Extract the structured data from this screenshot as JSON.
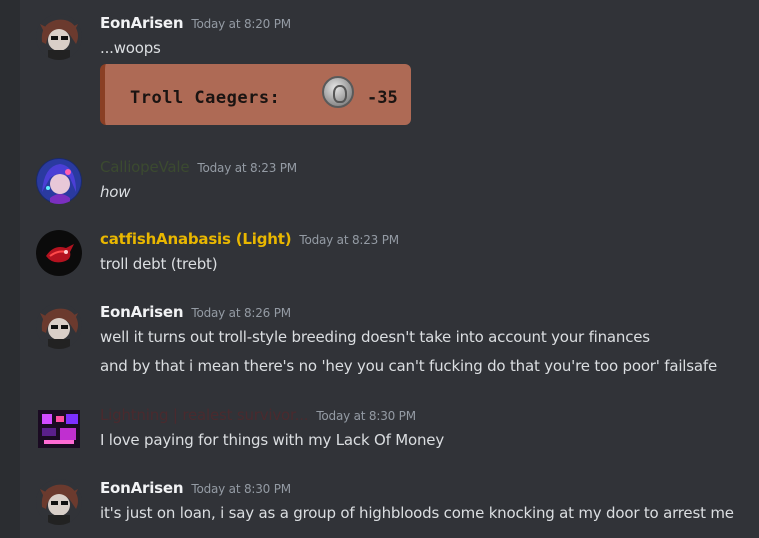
{
  "messages": [
    {
      "username": "EonArisen",
      "username_color": "#f2f3f5",
      "timestamp": "Today at 8:20 PM",
      "lines": [
        "...woops"
      ],
      "avatar_icon": "troll-girl-avatar",
      "embed": {
        "label": "Troll Caegers:",
        "value": "-35",
        "icon": "caeger-coin-icon"
      }
    },
    {
      "username": "CalliopeVale",
      "username_color": "#3b4a30",
      "timestamp": "Today at 8:23 PM",
      "lines": [
        "how"
      ],
      "avatar_icon": "anime-portrait-avatar"
    },
    {
      "username": "catfishAnabasis (Light)",
      "username_color": "#e9b700",
      "timestamp": "Today at 8:23 PM",
      "lines": [
        "troll debt (trebt)"
      ],
      "avatar_icon": "red-creature-avatar"
    },
    {
      "username": "EonArisen",
      "username_color": "#f2f3f5",
      "timestamp": "Today at 8:26 PM",
      "lines": [
        "well it turns out troll-style breeding doesn't take into account your finances",
        "and by that i mean there's no 'hey you can't fucking do that you're too poor' failsafe"
      ],
      "avatar_icon": "troll-girl-avatar"
    },
    {
      "username": "Lightning | realest survivor...",
      "username_color": "#4a2a2e",
      "timestamp": "Today at 8:30 PM",
      "lines": [
        "I love paying for things with my Lack Of Money"
      ],
      "avatar_icon": "neon-pixel-avatar"
    },
    {
      "username": "EonArisen",
      "username_color": "#f2f3f5",
      "timestamp": "Today at 8:30 PM",
      "lines": [
        "it's just on loan, i say as a group of highbloods come knocking at my door to arrest me"
      ],
      "avatar_icon": "troll-girl-avatar"
    }
  ]
}
